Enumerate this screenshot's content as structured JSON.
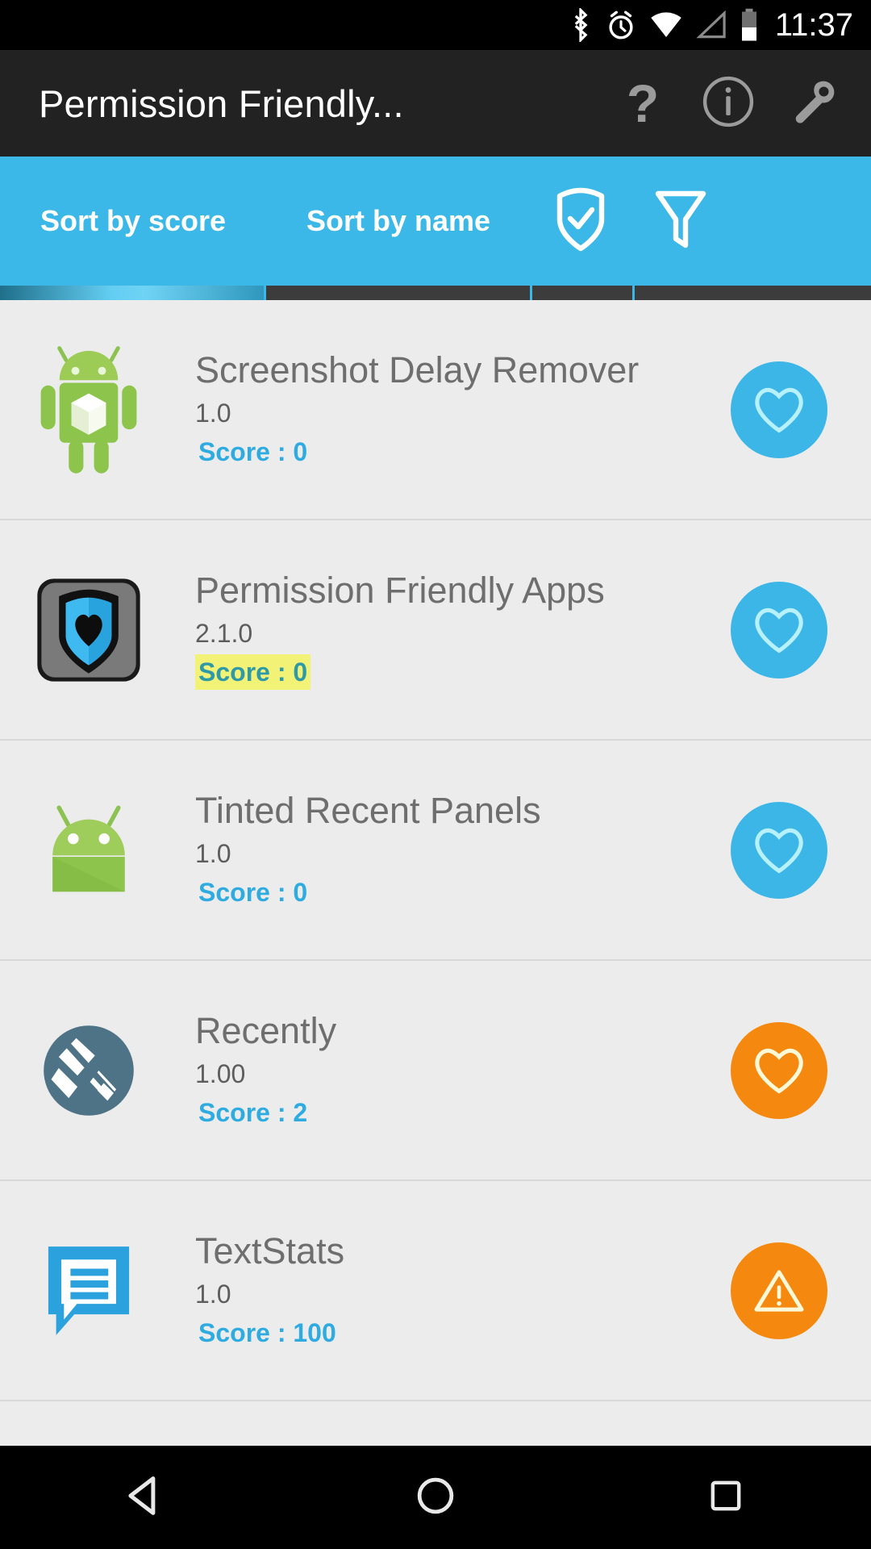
{
  "statusbar": {
    "time": "11:37",
    "icons": [
      "bluetooth-icon",
      "alarm-icon",
      "wifi-icon",
      "cell-signal-icon",
      "battery-icon"
    ]
  },
  "actionbar": {
    "title": "Permission Friendly...",
    "help_label": "?",
    "buttons": [
      "help-button",
      "info-button",
      "settings-wrench-button"
    ]
  },
  "tabbar": {
    "background_color": "#3bb8e8",
    "tabs": [
      {
        "label": "Sort by score",
        "selected": true
      },
      {
        "label": "Sort by name",
        "selected": false
      },
      {
        "label": "",
        "icon": "shield-check-icon",
        "selected": false
      },
      {
        "label": "",
        "icon": "filter-funnel-icon",
        "selected": false
      }
    ]
  },
  "list": {
    "items": [
      {
        "name": "Screenshot Delay Remover",
        "version": "1.0",
        "score_label": "Score : 0",
        "score_highlighted": false,
        "badge": "heart",
        "badge_color": "#3cb6e6",
        "icon": "android-robot-box-icon"
      },
      {
        "name": "Permission Friendly Apps",
        "version": "2.1.0",
        "score_label": "Score : 0",
        "score_highlighted": true,
        "badge": "heart",
        "badge_color": "#3cb6e6",
        "icon": "shield-heart-icon"
      },
      {
        "name": "Tinted Recent Panels",
        "version": "1.0",
        "score_label": "Score : 0",
        "score_highlighted": false,
        "badge": "heart",
        "badge_color": "#3cb6e6",
        "icon": "android-head-icon"
      },
      {
        "name": "Recently",
        "version": "1.00",
        "score_label": "Score : 2",
        "score_highlighted": false,
        "badge": "heart",
        "badge_color": "#f5880e",
        "icon": "recently-layers-icon"
      },
      {
        "name": "TextStats",
        "version": "1.0",
        "score_label": "Score : 100",
        "score_highlighted": false,
        "badge": "warning",
        "badge_color": "#f5880e",
        "icon": "text-bubble-icon"
      }
    ]
  },
  "navbar": {
    "buttons": [
      "back-button",
      "home-button",
      "recents-button"
    ]
  },
  "colors": {
    "accent_blue": "#3bb8e8",
    "score_blue": "#2eabe0",
    "highlight_yellow": "#f2f277",
    "orange": "#f5880e",
    "list_bg": "#ececec",
    "actionbar_bg": "#222222"
  }
}
